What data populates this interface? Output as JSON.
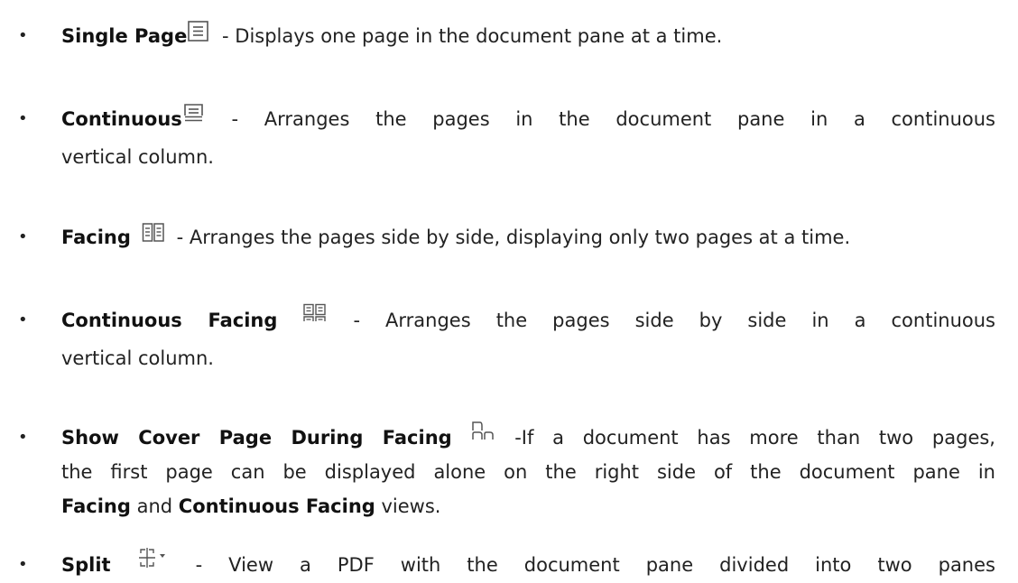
{
  "items": [
    {
      "term": "Single Page",
      "icon": "single-page-icon",
      "desc": " - Displays one page in the document pane at a time."
    },
    {
      "term": "Continuous",
      "icon": "continuous-icon",
      "desc_line1": " - Arranges the pages in the document pane in a continuous",
      "desc_line2": "vertical column."
    },
    {
      "term": "Facing",
      "icon": "facing-icon",
      "desc": " - Arranges the pages side by side, displaying only two pages at a time."
    },
    {
      "term": "Continuous Facing",
      "icon": "continuous-facing-icon",
      "desc_line1": " - Arranges the pages side by side in a continuous",
      "desc_line2": "vertical column."
    },
    {
      "term": "Show Cover Page During Facing",
      "icon": "cover-page-icon",
      "desc_line1": " -If a document has more than two pages,",
      "desc_line2": "the first page can be displayed alone on the right side of the document pane in",
      "line3_term1": "Facing",
      "line3_and": " and ",
      "line3_term2": "Continuous Facing",
      "line3_end": " views."
    },
    {
      "term": "Split",
      "icon": "split-icon",
      "desc": " - View a PDF with the document pane divided into two panes"
    }
  ]
}
